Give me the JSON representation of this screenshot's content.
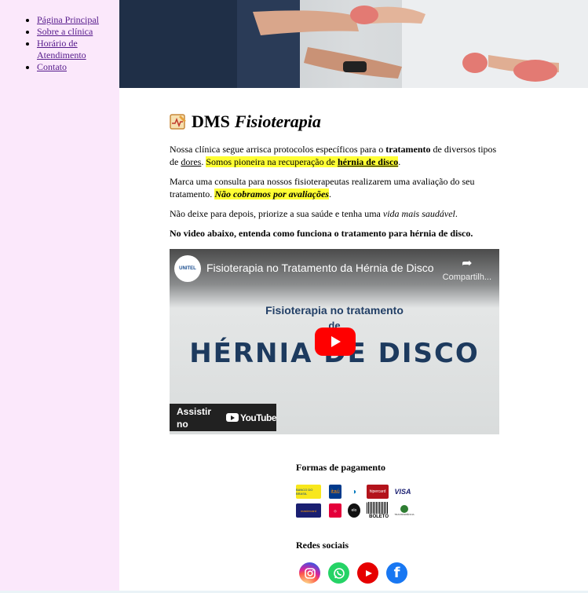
{
  "nav": {
    "items": [
      {
        "label": "Página Principal"
      },
      {
        "label": "Sobre a clínica"
      },
      {
        "label": "Horário de Atendimento"
      },
      {
        "label": "Contato"
      }
    ]
  },
  "hero": {
    "icon": "physiotherapy-photo"
  },
  "header": {
    "title_main": "DMS",
    "title_italic": "Fisioterapia",
    "logo_icon": "clinic-logo-icon"
  },
  "body": {
    "p1_a": "Nossa clínica segue arrisca protocolos específicos para o ",
    "p1_bold": "tratamento",
    "p1_b": " de diversos tipos de ",
    "p1_link": "dores",
    "p1_c": ". ",
    "p1_hl": "Somos pioneira na recuperação de ",
    "p1_hl_link": "hérnia de disco",
    "p1_end": ".",
    "p2_a": "Marca uma consulta para nossos fisioterapeutas realizarem uma avaliação do seu tratamento. ",
    "p2_hl": "Não cobramos por avaliações",
    "p2_end": ".",
    "p3_a": "Não deixe para depois, priorize a sua saúde e tenha uma ",
    "p3_it": "vida mais saudável",
    "p3_end": ".",
    "p4": "No video abaixo, entenda como funciona o tratamento para hérnia de disco."
  },
  "video": {
    "title": "Fisioterapia no Tratamento da Hérnia de Disco",
    "share": "Compartilh...",
    "line1": "Fisioterapia no tratamento",
    "line2": "de",
    "line3": "HÉRNIA DE DISCO",
    "watch_on": "Assistir no",
    "youtube": "YouTube",
    "channel_badge": "UNITEL"
  },
  "footer": {
    "payments_title": "Formas de pagamento",
    "payments": [
      {
        "name": "BANCO DO BRASIL",
        "color": "#f8e71c"
      },
      {
        "name": "itaú",
        "color": "#003a8c"
      },
      {
        "name": "diners",
        "color": "#0079be"
      },
      {
        "name": "hipercard",
        "color": "#b3131b"
      },
      {
        "name": "VISA",
        "color": "#1a1f71"
      },
      {
        "name": "mastercard",
        "color": "#eb001b"
      },
      {
        "name": "hiper",
        "color": "#e4003a"
      },
      {
        "name": "elo",
        "color": "#000000"
      },
      {
        "name": "BOLETO",
        "color": "#000000"
      },
      {
        "name": "TRANSFERÊNCIA",
        "color": "#2e7d32"
      }
    ],
    "social_title": "Redes sociais",
    "social": [
      {
        "name": "instagram-icon",
        "color": "#c13584"
      },
      {
        "name": "whatsapp-icon",
        "color": "#25d366"
      },
      {
        "name": "youtube-icon",
        "color": "#ff0000"
      },
      {
        "name": "facebook-icon",
        "color": "#1877f2"
      }
    ]
  }
}
